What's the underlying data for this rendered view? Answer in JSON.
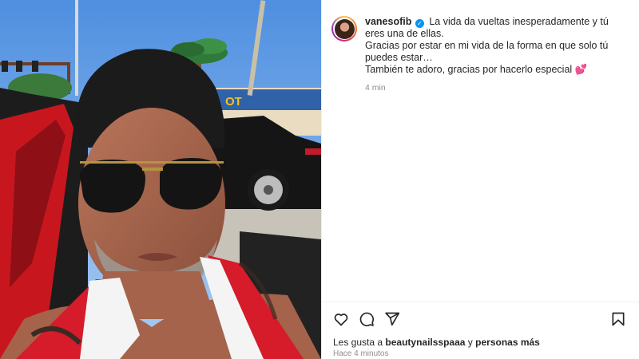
{
  "post": {
    "username": "vanesofib",
    "caption_lines": [
      "La vida da vueltas inesperadamente y tú eres una de ellas.",
      "Gracias por estar en mi vida de la forma en que solo tú puedes estar…",
      "También te adoro, gracias por hacerlo especial"
    ],
    "caption_emoji": "💕",
    "caption_time": "4 min",
    "verified_mark": "✓"
  },
  "likes": {
    "prefix": "Les gusta a",
    "user": "beautynailsspaaa",
    "connector": "y",
    "others": "personas más"
  },
  "timestamp": "Hace 4 minutos",
  "photo": {
    "sign_text": "OT"
  },
  "icons": {
    "like": "heart-icon",
    "comment": "comment-icon",
    "share": "share-icon",
    "save": "bookmark-icon"
  }
}
